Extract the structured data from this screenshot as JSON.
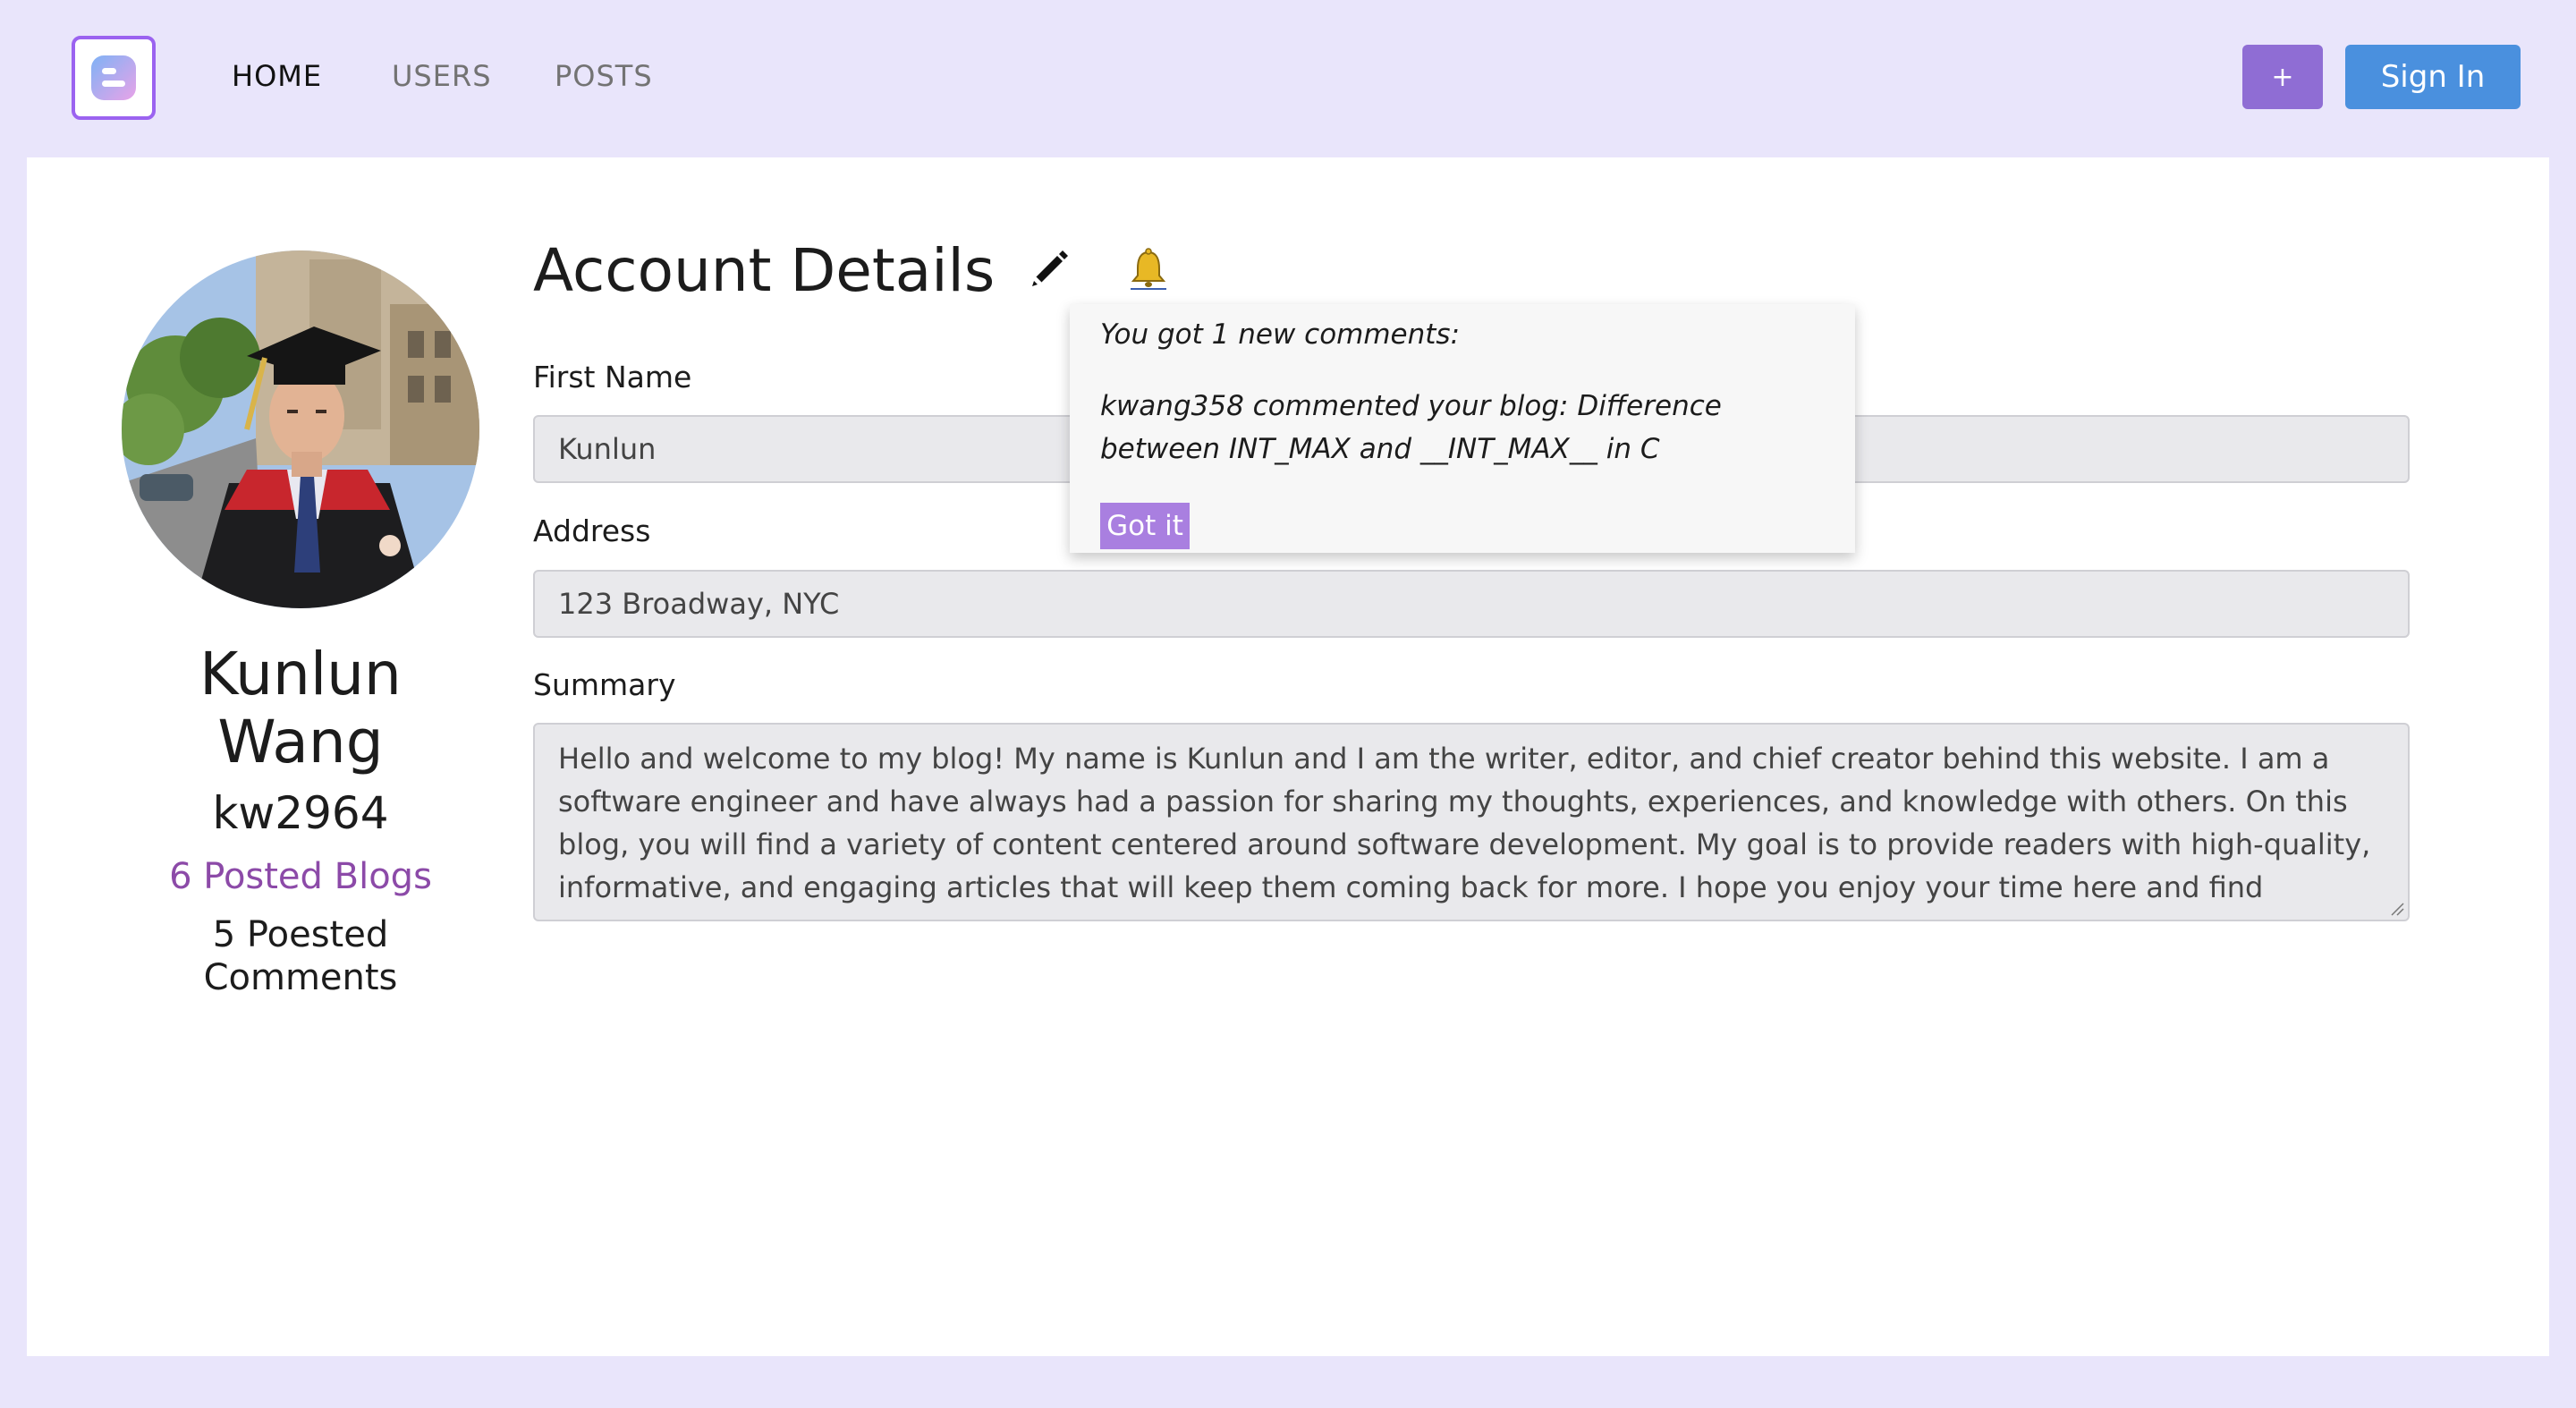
{
  "nav": {
    "links": [
      {
        "label": "HOME"
      },
      {
        "label": "USERS"
      },
      {
        "label": "POSTS"
      }
    ],
    "add_label": "+",
    "signin_label": "Sign In"
  },
  "profile": {
    "first_name": "Kunlun",
    "last_name": "Wang",
    "username": "kw2964",
    "blogs_text": "6 Posted Blogs",
    "comments_text": "5 Poested Comments"
  },
  "account": {
    "title": "Account Details",
    "first_name_label": "First Name",
    "first_name_value": "Kunlun",
    "address_label": "Address",
    "address_value": "123 Broadway, NYC",
    "summary_label": "Summary",
    "summary_value": "Hello and welcome to my blog! My name is Kunlun  and I am the writer, editor, and chief creator behind this website. I am a software engineer and have always had a passion for sharing my thoughts, experiences, and knowledge with others. On this blog, you will find a variety of content centered around software development. My goal is to provide readers with high-quality, informative, and engaging articles that will keep them coming back for more. I hope you enjoy your time here and find"
  },
  "notification": {
    "header": "You got 1 new comments:",
    "message": "kwang358 commented your blog: Difference between INT_MAX and __INT_MAX__ in C",
    "button_label": "Got it"
  },
  "icons": {
    "logo": "blogger-logo-icon",
    "edit": "pencil-icon",
    "notify": "bell-icon"
  },
  "colors": {
    "page_bg": "#e9e5fb",
    "accent_purple": "#8f6dd4",
    "signin_blue": "#4a90de",
    "blogs_link": "#8c4aa8",
    "gotit_button": "#a97fe0"
  }
}
